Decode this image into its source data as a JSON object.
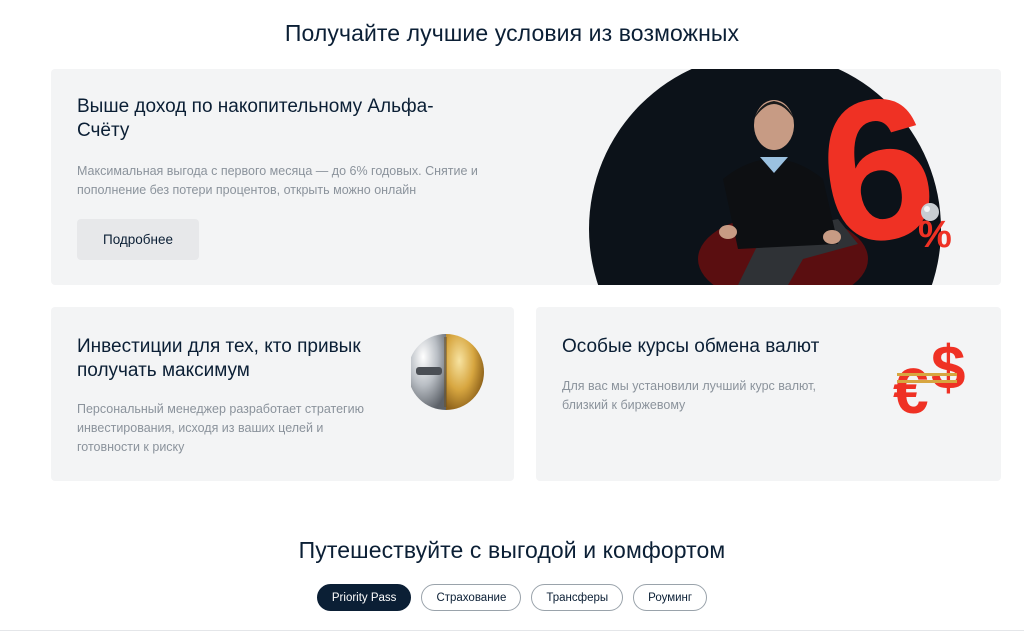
{
  "section1": {
    "title": "Получайте лучшие условия из возможных"
  },
  "cards": {
    "main": {
      "heading": "Выше доход по накопительному Альфа-Счёту",
      "text": "Максимальная выгода с первого месяца — до 6% годовых. Снятие и пополнение без потери процентов, открыть можно онлайн",
      "button_label": "Подробнее",
      "promo_figure": "6",
      "promo_percent": "%"
    },
    "invest": {
      "heading": "Инвестиции для тех, кто привык получать максимум",
      "text": "Персональный менеджер разработает стратегию инвестирования, исходя из ваших целей и готовности к риску"
    },
    "fx": {
      "heading": "Особые курсы обмена валют",
      "text": "Для вас мы установили лучший курс валют, близкий к биржевому"
    }
  },
  "section2": {
    "title": "Путешествуйте с выгодой и комфортом",
    "tabs": [
      {
        "label": "Priority Pass",
        "active": true
      },
      {
        "label": "Страхование",
        "active": false
      },
      {
        "label": "Трансферы",
        "active": false
      },
      {
        "label": "Роуминг",
        "active": false
      }
    ]
  },
  "colors": {
    "brand_red": "#ef3124",
    "text_dark": "#0b1f35",
    "text_muted": "#8b939c",
    "card_bg": "#f3f4f5",
    "active_tab": "#0b1f35"
  },
  "icons": {
    "invest_art": "gold-silver-sphere-icon",
    "fx_art": "euro-dollar-icon"
  }
}
